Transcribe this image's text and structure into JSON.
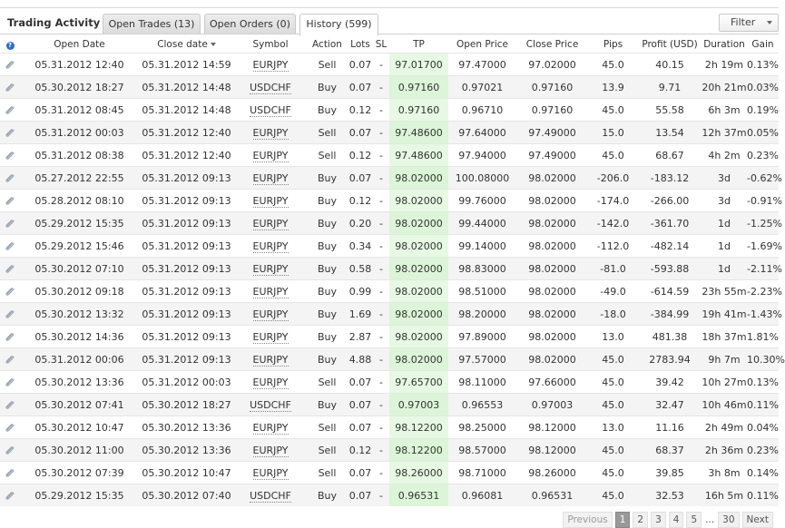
{
  "panel": {
    "title": "Trading Activity"
  },
  "tabs": [
    {
      "label": "Open Trades (13)"
    },
    {
      "label": "Open Orders (0)"
    },
    {
      "label": "History (599)"
    }
  ],
  "filter": {
    "label": "Filter"
  },
  "columns": {
    "open_date": "Open Date",
    "close_date": "Close date",
    "symbol": "Symbol",
    "action": "Action",
    "lots": "Lots",
    "sl": "SL",
    "tp": "TP",
    "open_price": "Open Price",
    "close_price": "Close Price",
    "pips": "Pips",
    "profit": "Profit (USD)",
    "duration": "Duration",
    "gain": "Gain"
  },
  "icons": {
    "info": "info-icon",
    "sort": "sort-down-icon",
    "row": "paperclip-icon"
  },
  "colors": {
    "positive": "#1a9a1a",
    "negative": "#d81e1e",
    "tp_highlight": "#e6f9e3"
  },
  "rows": [
    {
      "open_date": "05.31.2012 12:40",
      "close_date": "05.31.2012 14:59",
      "symbol": "EURJPY",
      "action": "Sell",
      "lots": "0.07",
      "sl": "-",
      "tp": "97.01700",
      "open_price": "97.47000",
      "close_price": "97.02000",
      "pips": "45.0",
      "profit": "40.15",
      "duration": "2h 19m",
      "gain": "0.13%"
    },
    {
      "open_date": "05.30.2012 18:27",
      "close_date": "05.31.2012 14:48",
      "symbol": "USDCHF",
      "action": "Buy",
      "lots": "0.07",
      "sl": "-",
      "tp": "0.97160",
      "open_price": "0.97021",
      "close_price": "0.97160",
      "pips": "13.9",
      "profit": "9.71",
      "duration": "20h 21m",
      "gain": "0.03%"
    },
    {
      "open_date": "05.31.2012 08:45",
      "close_date": "05.31.2012 14:48",
      "symbol": "USDCHF",
      "action": "Buy",
      "lots": "0.12",
      "sl": "-",
      "tp": "0.97160",
      "open_price": "0.96710",
      "close_price": "0.97160",
      "pips": "45.0",
      "profit": "55.58",
      "duration": "6h 3m",
      "gain": "0.19%"
    },
    {
      "open_date": "05.31.2012 00:03",
      "close_date": "05.31.2012 12:40",
      "symbol": "EURJPY",
      "action": "Sell",
      "lots": "0.07",
      "sl": "-",
      "tp": "97.48600",
      "open_price": "97.64000",
      "close_price": "97.49000",
      "pips": "15.0",
      "profit": "13.54",
      "duration": "12h 37m",
      "gain": "0.05%"
    },
    {
      "open_date": "05.31.2012 08:38",
      "close_date": "05.31.2012 12:40",
      "symbol": "EURJPY",
      "action": "Sell",
      "lots": "0.12",
      "sl": "-",
      "tp": "97.48600",
      "open_price": "97.94000",
      "close_price": "97.49000",
      "pips": "45.0",
      "profit": "68.67",
      "duration": "4h 2m",
      "gain": "0.23%"
    },
    {
      "open_date": "05.27.2012 22:55",
      "close_date": "05.31.2012 09:13",
      "symbol": "EURJPY",
      "action": "Buy",
      "lots": "0.07",
      "sl": "-",
      "tp": "98.02000",
      "open_price": "100.08000",
      "close_price": "98.02000",
      "pips": "-206.0",
      "profit": "-183.12",
      "duration": "3d",
      "gain": "-0.62%"
    },
    {
      "open_date": "05.28.2012 08:10",
      "close_date": "05.31.2012 09:13",
      "symbol": "EURJPY",
      "action": "Buy",
      "lots": "0.12",
      "sl": "-",
      "tp": "98.02000",
      "open_price": "99.76000",
      "close_price": "98.02000",
      "pips": "-174.0",
      "profit": "-266.00",
      "duration": "3d",
      "gain": "-0.91%"
    },
    {
      "open_date": "05.29.2012 15:35",
      "close_date": "05.31.2012 09:13",
      "symbol": "EURJPY",
      "action": "Buy",
      "lots": "0.20",
      "sl": "-",
      "tp": "98.02000",
      "open_price": "99.44000",
      "close_price": "98.02000",
      "pips": "-142.0",
      "profit": "-361.70",
      "duration": "1d",
      "gain": "-1.25%"
    },
    {
      "open_date": "05.29.2012 15:46",
      "close_date": "05.31.2012 09:13",
      "symbol": "EURJPY",
      "action": "Buy",
      "lots": "0.34",
      "sl": "-",
      "tp": "98.02000",
      "open_price": "99.14000",
      "close_price": "98.02000",
      "pips": "-112.0",
      "profit": "-482.14",
      "duration": "1d",
      "gain": "-1.69%"
    },
    {
      "open_date": "05.30.2012 07:10",
      "close_date": "05.31.2012 09:13",
      "symbol": "EURJPY",
      "action": "Buy",
      "lots": "0.58",
      "sl": "-",
      "tp": "98.02000",
      "open_price": "98.83000",
      "close_price": "98.02000",
      "pips": "-81.0",
      "profit": "-593.88",
      "duration": "1d",
      "gain": "-2.11%"
    },
    {
      "open_date": "05.30.2012 09:18",
      "close_date": "05.31.2012 09:13",
      "symbol": "EURJPY",
      "action": "Buy",
      "lots": "0.99",
      "sl": "-",
      "tp": "98.02000",
      "open_price": "98.51000",
      "close_price": "98.02000",
      "pips": "-49.0",
      "profit": "-614.59",
      "duration": "23h 55m",
      "gain": "-2.23%"
    },
    {
      "open_date": "05.30.2012 13:32",
      "close_date": "05.31.2012 09:13",
      "symbol": "EURJPY",
      "action": "Buy",
      "lots": "1.69",
      "sl": "-",
      "tp": "98.02000",
      "open_price": "98.20000",
      "close_price": "98.02000",
      "pips": "-18.0",
      "profit": "-384.99",
      "duration": "19h 41m",
      "gain": "-1.43%"
    },
    {
      "open_date": "05.30.2012 14:36",
      "close_date": "05.31.2012 09:13",
      "symbol": "EURJPY",
      "action": "Buy",
      "lots": "2.87",
      "sl": "-",
      "tp": "98.02000",
      "open_price": "97.89000",
      "close_price": "98.02000",
      "pips": "13.0",
      "profit": "481.38",
      "duration": "18h 37m",
      "gain": "1.81%"
    },
    {
      "open_date": "05.31.2012 00:06",
      "close_date": "05.31.2012 09:13",
      "symbol": "EURJPY",
      "action": "Buy",
      "lots": "4.88",
      "sl": "-",
      "tp": "98.02000",
      "open_price": "97.57000",
      "close_price": "98.02000",
      "pips": "45.0",
      "profit": "2783.94",
      "duration": "9h 7m",
      "gain": "10.30%"
    },
    {
      "open_date": "05.30.2012 13:36",
      "close_date": "05.31.2012 00:03",
      "symbol": "EURJPY",
      "action": "Sell",
      "lots": "0.07",
      "sl": "-",
      "tp": "97.65700",
      "open_price": "98.11000",
      "close_price": "97.66000",
      "pips": "45.0",
      "profit": "39.42",
      "duration": "10h 27m",
      "gain": "0.13%"
    },
    {
      "open_date": "05.30.2012 07:41",
      "close_date": "05.30.2012 18:27",
      "symbol": "USDCHF",
      "action": "Buy",
      "lots": "0.07",
      "sl": "-",
      "tp": "0.97003",
      "open_price": "0.96553",
      "close_price": "0.97003",
      "pips": "45.0",
      "profit": "32.47",
      "duration": "10h 46m",
      "gain": "0.11%"
    },
    {
      "open_date": "05.30.2012 10:47",
      "close_date": "05.30.2012 13:36",
      "symbol": "EURJPY",
      "action": "Sell",
      "lots": "0.07",
      "sl": "-",
      "tp": "98.12200",
      "open_price": "98.25000",
      "close_price": "98.12000",
      "pips": "13.0",
      "profit": "11.16",
      "duration": "2h 49m",
      "gain": "0.04%"
    },
    {
      "open_date": "05.30.2012 11:00",
      "close_date": "05.30.2012 13:36",
      "symbol": "EURJPY",
      "action": "Sell",
      "lots": "0.12",
      "sl": "-",
      "tp": "98.12200",
      "open_price": "98.57000",
      "close_price": "98.12000",
      "pips": "45.0",
      "profit": "68.37",
      "duration": "2h 36m",
      "gain": "0.23%"
    },
    {
      "open_date": "05.30.2012 07:39",
      "close_date": "05.30.2012 10:47",
      "symbol": "EURJPY",
      "action": "Sell",
      "lots": "0.07",
      "sl": "-",
      "tp": "98.26000",
      "open_price": "98.71000",
      "close_price": "98.26000",
      "pips": "45.0",
      "profit": "39.85",
      "duration": "3h 8m",
      "gain": "0.14%"
    },
    {
      "open_date": "05.29.2012 15:35",
      "close_date": "05.30.2012 07:40",
      "symbol": "USDCHF",
      "action": "Buy",
      "lots": "0.07",
      "sl": "-",
      "tp": "0.96531",
      "open_price": "0.96081",
      "close_price": "0.96531",
      "pips": "45.0",
      "profit": "32.53",
      "duration": "16h 5m",
      "gain": "0.11%"
    }
  ],
  "pagination": {
    "previous": "Previous",
    "pages": [
      "1",
      "2",
      "3",
      "4",
      "5"
    ],
    "ellipsis": "...",
    "last": "30",
    "next": "Next",
    "current": "1"
  }
}
